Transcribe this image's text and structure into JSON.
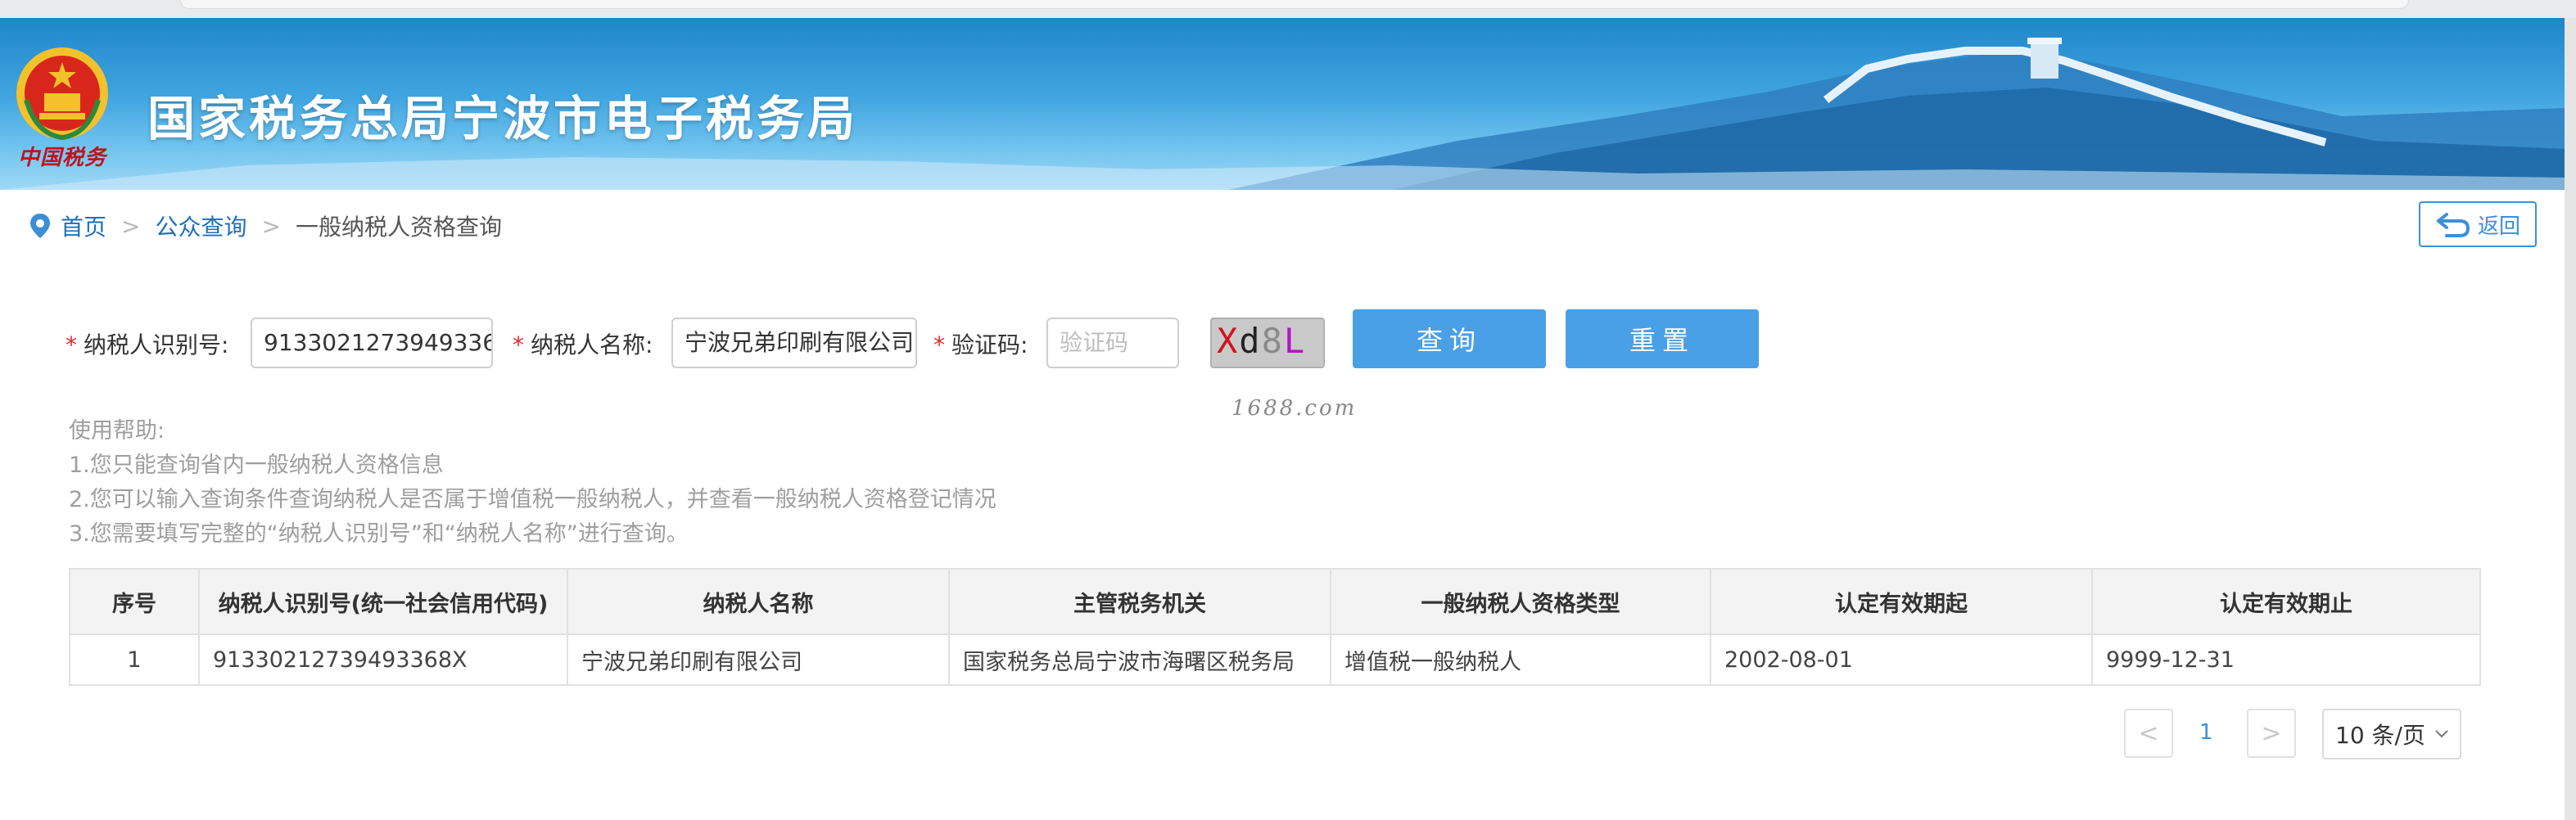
{
  "header": {
    "title": "国家税务总局宁波市电子税务局",
    "emblem_caption": "中国税务"
  },
  "breadcrumb": {
    "home": "首页",
    "separator": ">",
    "section": "公众查询",
    "current": "一般纳税人资格查询"
  },
  "back_button": {
    "label": "返回"
  },
  "form": {
    "required_mark": "*",
    "tax_id": {
      "label": "纳税人识别号:",
      "value": "91330212739493368X"
    },
    "taxpayer_name": {
      "label": "纳税人名称:",
      "value": "宁波兄弟印刷有限公司"
    },
    "captcha": {
      "label": "验证码:",
      "value": "",
      "placeholder": "验证码",
      "image_text": [
        "X",
        "d",
        "8",
        "L"
      ]
    },
    "query_button": "查询",
    "reset_button": "重置"
  },
  "watermark": "1688.com",
  "help": {
    "title": "使用帮助:",
    "lines": [
      "1.您只能查询省内一般纳税人资格信息",
      "2.您可以输入查询条件查询纳税人是否属于增值税一般纳税人，并查看一般纳税人资格登记情况",
      "3.您需要填写完整的“纳税人识别号”和“纳税人名称”进行查询。"
    ]
  },
  "table": {
    "columns": [
      "序号",
      "纳税人识别号(统一社会信用代码)",
      "纳税人名称",
      "主管税务机关",
      "一般纳税人资格类型",
      "认定有效期起",
      "认定有效期止"
    ],
    "rows": [
      [
        "1",
        "91330212739493368X",
        "宁波兄弟印刷有限公司",
        "国家税务总局宁波市海曙区税务局",
        "增值税一般纳税人",
        "2002-08-01",
        "9999-12-31"
      ]
    ]
  },
  "pagination": {
    "prev": "<",
    "current_page": "1",
    "next": ">",
    "page_size": "10 条/页"
  },
  "colors": {
    "accent": "#4aa0e6",
    "link": "#1e6fb8",
    "required": "#e02b2b"
  }
}
